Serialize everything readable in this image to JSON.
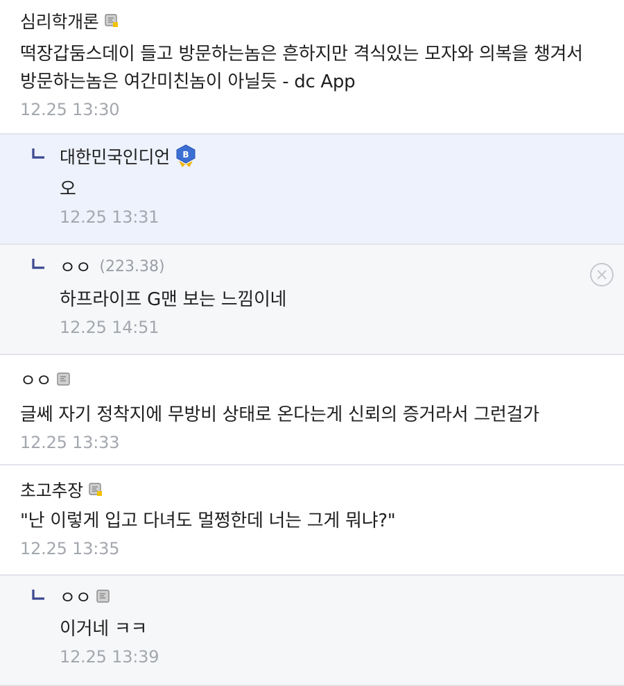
{
  "comments": [
    {
      "nick": "심리학개론",
      "text_lines": [
        "떡장갑둠스데이 들고 방문하는놈은 흔하지만 격식있는 모자와 의복을 챙겨서",
        "방문하는놈은 여간미친놈이 아닐듯 - dc App"
      ],
      "time": "12.25 13:30"
    },
    {
      "nick": "대한민국인디언",
      "text": "오",
      "time": "12.25 13:31",
      "badge": "B"
    },
    {
      "nick": "ㅇㅇ",
      "ip": "(223.38)",
      "text": "하프라이프 G맨 보는 느낌이네",
      "time": "12.25 14:51"
    },
    {
      "nick": "ㅇㅇ",
      "text": "글쎄 자기 정착지에 무방비 상태로 온다는게 신뢰의 증거라서 그런걸가",
      "time": "12.25 13:33"
    },
    {
      "nick": "초고추장",
      "text": "\"난 이렇게 입고 다녀도 멀쩡한데 너는 그게 뭐냐?\"",
      "time": "12.25 13:35"
    },
    {
      "nick": "ㅇㅇ",
      "text": "이거네 ㅋㅋ",
      "time": "12.25 13:39"
    }
  ],
  "colors": {
    "highlight_bg": "#edf2fc",
    "reply_bg": "#f6f7f9",
    "divider": "#e2e4ea",
    "reply_arrow": "#3b4890",
    "badge_blue": "#3b6fd4",
    "badge_gold": "#f0b400"
  },
  "icons": {
    "fixed_nick": "fixed-nick-icon",
    "half_fixed_nick": "half-fixed-nick-icon",
    "reply": "reply-arrow-icon",
    "delete": "delete-circle-icon",
    "badge": "b-badge-icon"
  }
}
